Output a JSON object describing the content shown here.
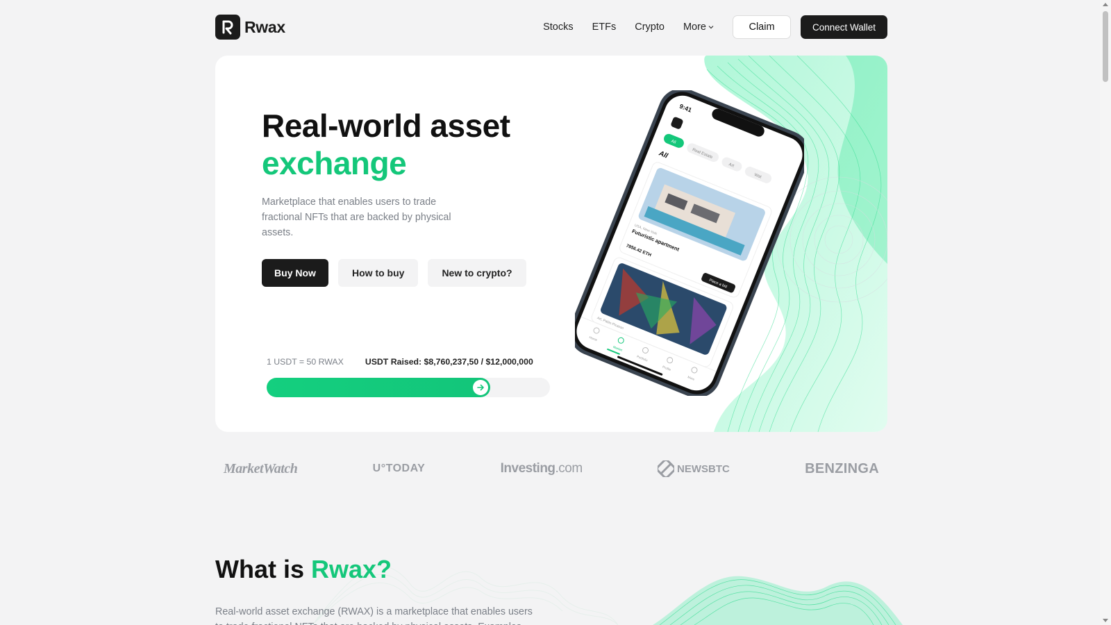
{
  "brand": {
    "name": "Rwax"
  },
  "nav": {
    "items": [
      {
        "label": "Stocks"
      },
      {
        "label": "ETFs"
      },
      {
        "label": "Crypto"
      }
    ],
    "more_label": "More",
    "claim_label": "Claim",
    "wallet_label": "Connect Wallet"
  },
  "hero": {
    "title_line1": "Real-world asset",
    "title_accent": "exchange",
    "description": "Marketplace that enables users to trade fractional NFTs that are backed by physical assets.",
    "buy_label": "Buy Now",
    "how_label": "How to buy",
    "new_label": "New to crypto?",
    "rate": "1 USDT = 50 RWAX",
    "raised": "USDT Raised: $8,760,237,50 / $12,000,000",
    "progress_fraction": 0.79
  },
  "phone": {
    "time": "9:41",
    "tabs": [
      "All",
      "Real Estate",
      "Art",
      "Wat"
    ],
    "section_title": "All",
    "card1": {
      "location": "USA, New-York",
      "title": "Futuristic apartment",
      "price": "7856.42 ETH",
      "action": "Place a bid"
    },
    "card2": {
      "location": "Art, Pablo Picasso"
    },
    "bottom_nav": [
      "Home",
      "Market",
      "Portfolio",
      "Profile",
      "More"
    ]
  },
  "press": {
    "logos": [
      "MarketWatch",
      "U°TODAY",
      "Investing",
      ".com",
      "NEWSBTC",
      "BENZINGA"
    ]
  },
  "what": {
    "title_prefix": "What is ",
    "title_accent": "Rwax?",
    "description": "Real-world asset exchange (RWAX) is a marketplace that enables users to trade fractional NFTs that are backed by physical assets. Examples uses"
  },
  "colors": {
    "accent": "#14c77a",
    "dark": "#1b1b1b",
    "muted": "#7a7f87",
    "background": "#f3f3f4"
  },
  "icons": {
    "logo": "rwax-logo-icon",
    "more": "chevron-down-icon",
    "progress": "arrow-right-icon"
  }
}
